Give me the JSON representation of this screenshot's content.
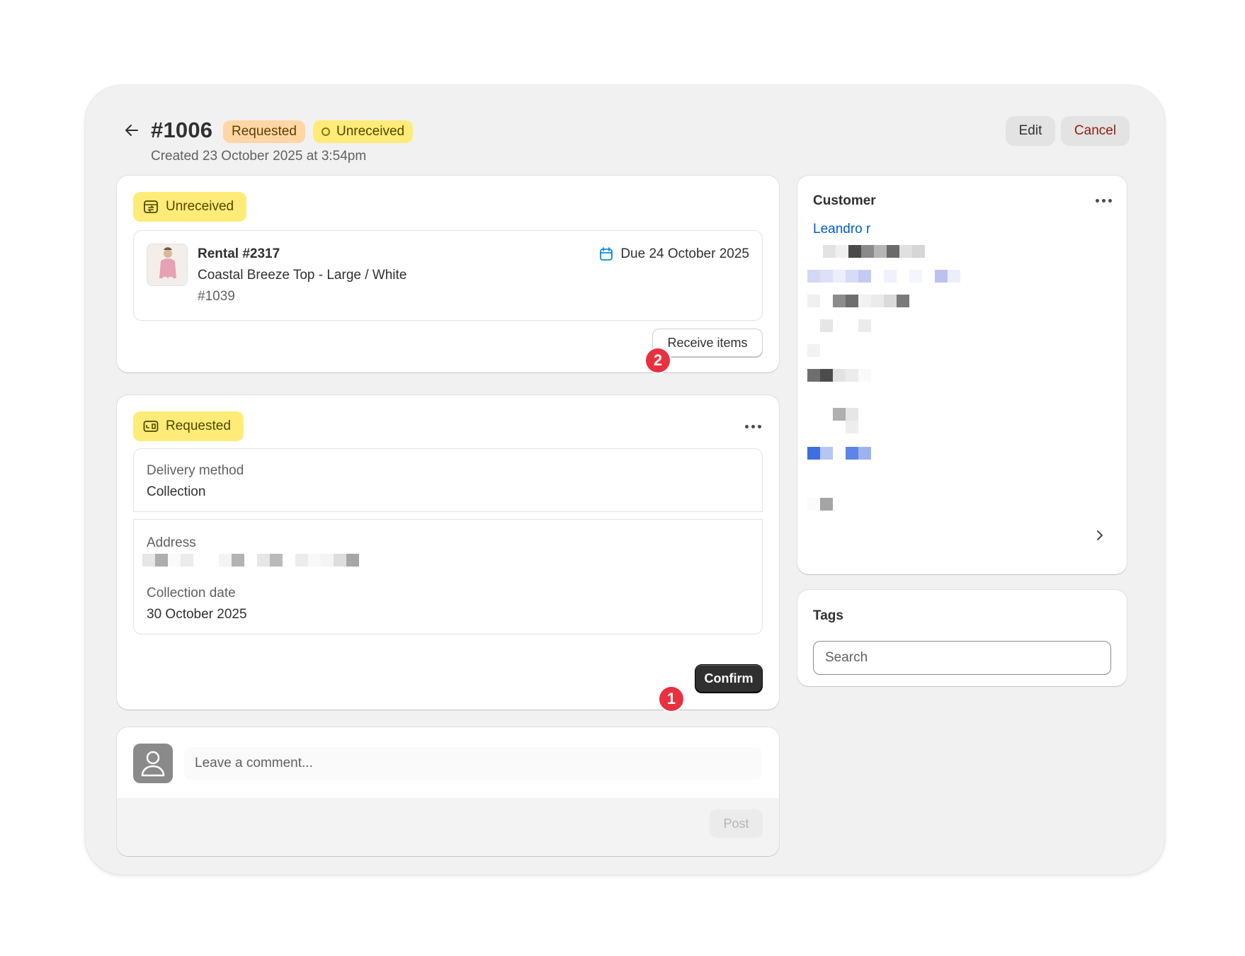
{
  "order": {
    "number": "#1006",
    "badge_requested": "Requested",
    "badge_unreceived": "Unreceived",
    "created": "Created 23 October 2025 at 3:54pm"
  },
  "header_actions": {
    "edit": "Edit",
    "cancel": "Cancel"
  },
  "return_card": {
    "status": "Unreceived",
    "rental_title": "Rental #2317",
    "product": "Coastal Breeze Top - Large / White",
    "sku": "#1039",
    "due": "Due 24 October 2025",
    "receive_button": "Receive items",
    "step_badge": "2"
  },
  "delivery_card": {
    "status": "Requested",
    "delivery_method_label": "Delivery method",
    "delivery_method_value": "Collection",
    "address_label": "Address",
    "collection_date_label": "Collection date",
    "collection_date_value": "30 October 2025",
    "confirm_button": "Confirm",
    "step_badge": "1"
  },
  "comment": {
    "placeholder": "Leave a comment...",
    "post_button": "Post"
  },
  "customer": {
    "heading": "Customer",
    "name": "Leandro r"
  },
  "tags": {
    "heading": "Tags",
    "placeholder": "Search"
  },
  "icons": [
    "arrow-left-icon",
    "calendar-icon",
    "return-box-icon",
    "delivery-icon",
    "more-horizontal-icon",
    "person-icon",
    "chevron-right-icon"
  ],
  "colors": {
    "badge_orange": "#ffd6a4",
    "badge_yellow": "#ffeb78",
    "link_blue": "#005bd3",
    "cancel_red": "#8e1f0b",
    "step_red": "#e8313f"
  }
}
